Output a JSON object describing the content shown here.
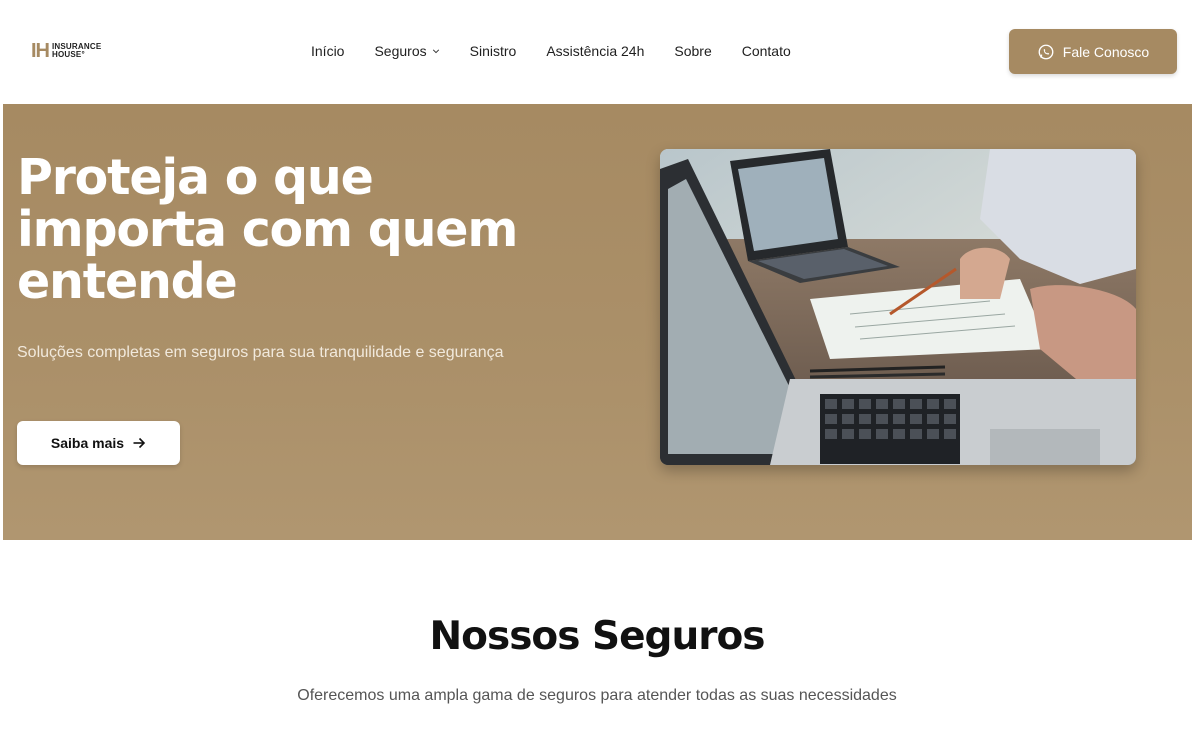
{
  "brand": {
    "mark": "IH",
    "line1": "INSURANCE",
    "line2": "HOUSE°",
    "accent_color": "#a68a62"
  },
  "nav": {
    "items": [
      {
        "label": "Início"
      },
      {
        "label": "Seguros",
        "icon": "chevron-down-icon"
      },
      {
        "label": "Sinistro"
      },
      {
        "label": "Assistência 24h"
      },
      {
        "label": "Sobre"
      },
      {
        "label": "Contato"
      }
    ]
  },
  "header_cta": {
    "label": "Fale Conosco",
    "icon": "whatsapp-icon"
  },
  "hero": {
    "title": "Proteja o que importa com quem entende",
    "subtitle": "Soluções completas em seguros para sua tranquilidade e segurança",
    "button_label": "Saiba mais",
    "button_icon": "arrow-right-icon",
    "image_desc_icon": "laptop-workspace-image"
  },
  "section": {
    "title": "Nossos Seguros",
    "subtitle": "Oferecemos uma ampla gama de seguros para atender todas as suas necessidades"
  }
}
